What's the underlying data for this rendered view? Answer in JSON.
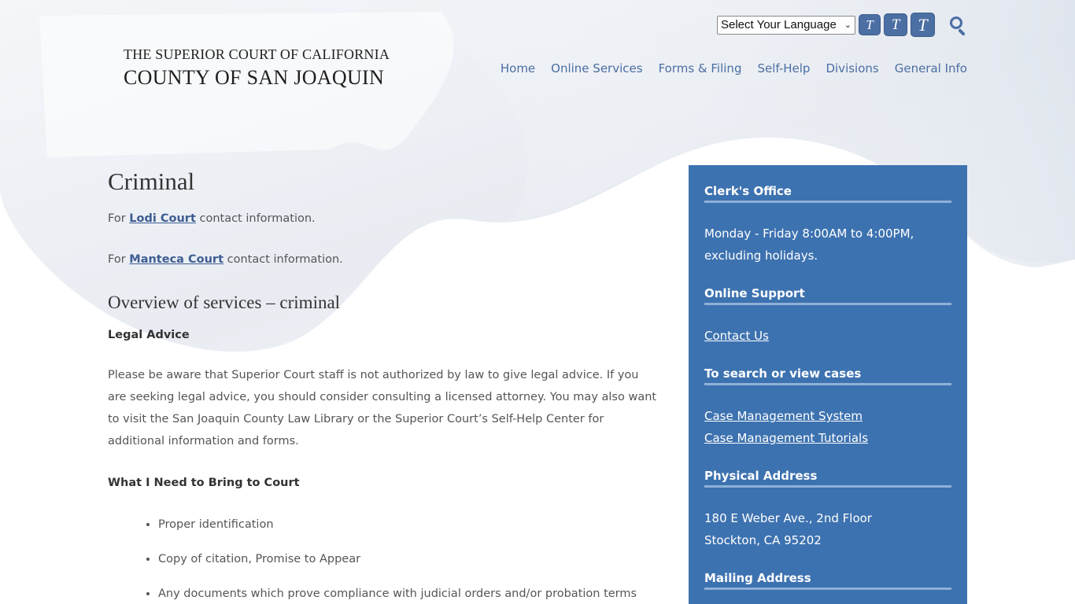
{
  "header": {
    "logo_line1": "THE SUPERIOR COURT OF CALIFORNIA",
    "logo_line2": "COUNTY OF SAN JOAQUIN",
    "language_select": "Select Your Language",
    "text_size_buttons": [
      "T",
      "T",
      "T"
    ],
    "search_icon": "search-icon"
  },
  "nav": {
    "items": [
      "Home",
      "Online Services",
      "Forms & Filing",
      "Self-Help",
      "Divisions",
      "General Info"
    ]
  },
  "main": {
    "title": "Criminal",
    "lodi": {
      "prefix": "For ",
      "link": "Lodi Court",
      "suffix": " contact information."
    },
    "manteca": {
      "prefix": "For ",
      "link": "Manteca Court",
      "suffix": " contact information."
    },
    "overview_heading": "Overview of services – criminal",
    "legal_advice_heading": "Legal Advice",
    "legal_advice_text": "Please be aware that Superior Court staff is not authorized by law to give legal advice. If you are seeking legal advice, you should consider consulting a licensed attorney.  You may also want to visit the San Joaquin County Law Library or the Superior Court’s Self-Help Center for additional information and forms.",
    "bring_heading": "What I Need to Bring to Court",
    "bring_items": [
      "Proper identification",
      "Copy of citation, Promise to Appear",
      "Any documents which prove compliance with judicial orders and/or probation terms"
    ]
  },
  "sidebar": {
    "clerk_heading": "Clerk's Office",
    "clerk_hours": "Monday - Friday 8:00AM to 4:00PM, excluding holidays.",
    "support_heading": "Online Support",
    "contact_link": "Contact Us",
    "cases_heading": "To search or view cases",
    "cms_link": "Case Management System",
    "tutorials_link": "Case Management Tutorials",
    "physical_heading": "Physical Address",
    "address_line1": "180 E Weber Ave., 2nd Floor",
    "address_line2": "Stockton, CA 95202",
    "mailing_heading": "Mailing Address"
  },
  "colors": {
    "accent": "#4b6ea3",
    "sidebar_bg": "#3d72b0"
  }
}
